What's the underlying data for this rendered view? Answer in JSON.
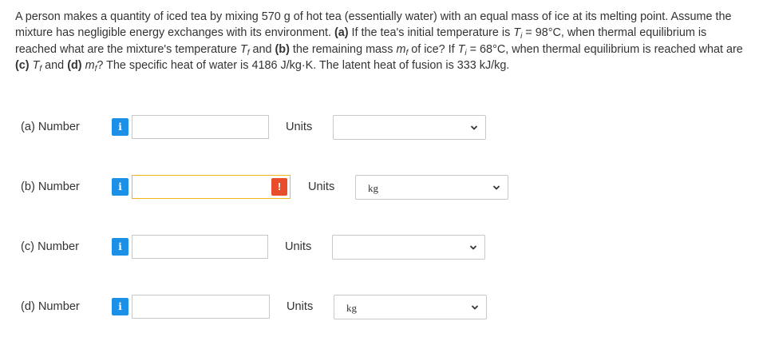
{
  "problem": {
    "s1": "A person makes a quantity of iced tea by mixing 570 g of hot tea (essentially water) with an equal mass of ice at its melting point. Assume the mixture has negligible energy exchanges with its environment. ",
    "a_tag": "(a)",
    "s2": " If the tea's initial temperature is ",
    "T": "T",
    "i": "i",
    "f": "f",
    "m": "m",
    "s3": " = 98°C, when thermal equilibrium is reached what are the mixture's temperature ",
    "s4": " and ",
    "b_tag": "(b)",
    "s5": " the remaining mass ",
    "s6": " of ice? If ",
    "s7": " = 68°C, when thermal equilibrium is reached what are ",
    "c_tag": "(c)",
    "s8": " ",
    "s9": " and ",
    "d_tag": "(d)",
    "s10": " ",
    "s11": "? The specific heat of water is 4186 J/kg·K. The latent heat of fusion is 333 kJ/kg."
  },
  "parts": [
    {
      "label": "(a)  Number",
      "value": "",
      "units_label": "Units",
      "units_value": "",
      "warning": false
    },
    {
      "label": "(b)  Number",
      "value": "",
      "units_label": "Units",
      "units_value": "kg",
      "warning": true,
      "warning_symbol": "!"
    },
    {
      "label": "(c)  Number",
      "value": "",
      "units_label": "Units",
      "units_value": "",
      "warning": false
    },
    {
      "label": "(d)  Number",
      "value": "",
      "units_label": "Units",
      "units_value": "kg",
      "warning": false
    }
  ],
  "info_symbol": "i",
  "colors": {
    "info": "#1c90e6",
    "warning": "#e84e2b",
    "warning_border": "#f1b41a"
  }
}
